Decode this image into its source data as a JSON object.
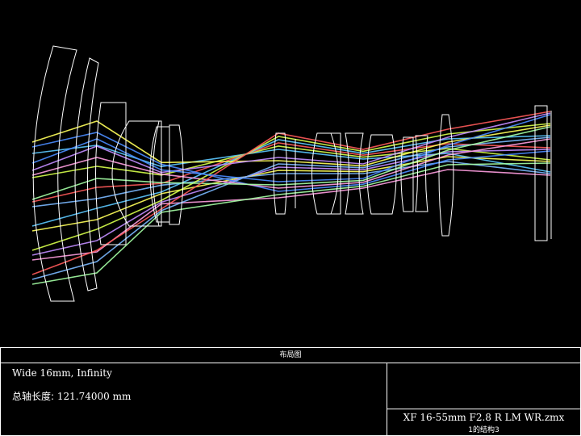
{
  "diagram": {
    "description": "optical layout",
    "ray_colors": [
      "#5bc8ff",
      "#7ab8ff",
      "#ff9de0",
      "#d6ff4a",
      "#ffff5a",
      "#a4ffa4",
      "#ff5a5a",
      "#c18cff",
      "#4a8cff"
    ],
    "lens_stroke": "#ffffff",
    "background": "#000000"
  },
  "info_panel": {
    "title": "布局图",
    "config_line": "Wide 16mm, Infinity",
    "total_length_label": "总轴长度:",
    "total_length_value": "121.74000 mm",
    "file_name": "XF 16-55mm F2.8 R LM WR.zmx",
    "config_index": "1的结构3"
  }
}
